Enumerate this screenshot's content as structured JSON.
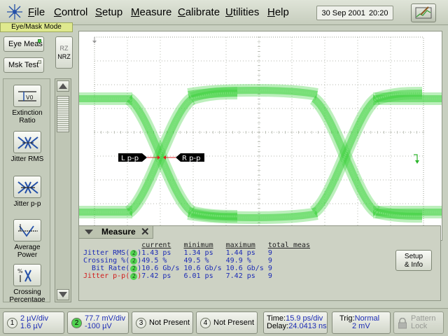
{
  "menubar": {
    "items": [
      "File",
      "Control",
      "Setup",
      "Measure",
      "Calibrate",
      "Utilities",
      "Help"
    ],
    "date": "30 Sep 2001",
    "time": "20:20"
  },
  "left_panel": {
    "mode_label": "Eye/Mask Mode",
    "eye_meas_label": "Eye Meas",
    "mask_test_label": "Msk Test",
    "rz_label": "RZ",
    "nrz_label": "NRZ",
    "measurements": [
      "Extinction Ratio",
      "Jitter RMS",
      "Jitter p-p",
      "Average Power",
      "Crossing Percentage"
    ]
  },
  "scope": {
    "marker_left": "L p-p",
    "marker_right": "R p-p",
    "trace_color": "#3fd23f",
    "grid_color": "#9ba093"
  },
  "measure_panel": {
    "title": "Measure",
    "columns": [
      "current",
      "minimum",
      "maximum",
      "total meas"
    ],
    "rows": [
      {
        "name": "Jitter RMS(",
        "ch": "2",
        "current": "1.43 ps",
        "minimum": "1.34 ps",
        "maximum": "1.44 ps",
        "total": "9",
        "highlight": false
      },
      {
        "name": "Crossing %(",
        "ch": "2",
        "current": "49.5 %",
        "minimum": "49.5 %",
        "maximum": "49.9 %",
        "total": "9",
        "highlight": false
      },
      {
        "name": "Bit Rate(",
        "ch": "2",
        "current": "10.6 Gb/s",
        "minimum": "10.6 Gb/s",
        "maximum": "10.6 Gb/s",
        "total": "9",
        "highlight": false
      },
      {
        "name": "Jitter p-p(",
        "ch": "2",
        "current": "7.42 ps",
        "minimum": "6.01 ps",
        "maximum": "7.42 ps",
        "total": "9",
        "highlight": true
      }
    ],
    "setup_label_1": "Setup",
    "setup_label_2": "& Info"
  },
  "status": {
    "ch1_num": "1",
    "ch1_line1": "2 µV/div",
    "ch1_line2": "1.6 µV",
    "ch2_num": "2",
    "ch2_line1": "77.7 mV/div",
    "ch2_line2": "-100 µV",
    "ch3_num": "3",
    "ch3_text": "Not Present",
    "ch4_num": "4",
    "ch4_text": "Not Present",
    "time_label": "Time:",
    "time_value": "15.9 ps/div",
    "delay_label": "Delay:",
    "delay_value": "24.0413 ns",
    "trig_label": "Trig:",
    "trig_value": "Normal",
    "trig_level": "2 mV",
    "pattern_lock_1": "Pattern",
    "pattern_lock_2": "Lock"
  }
}
